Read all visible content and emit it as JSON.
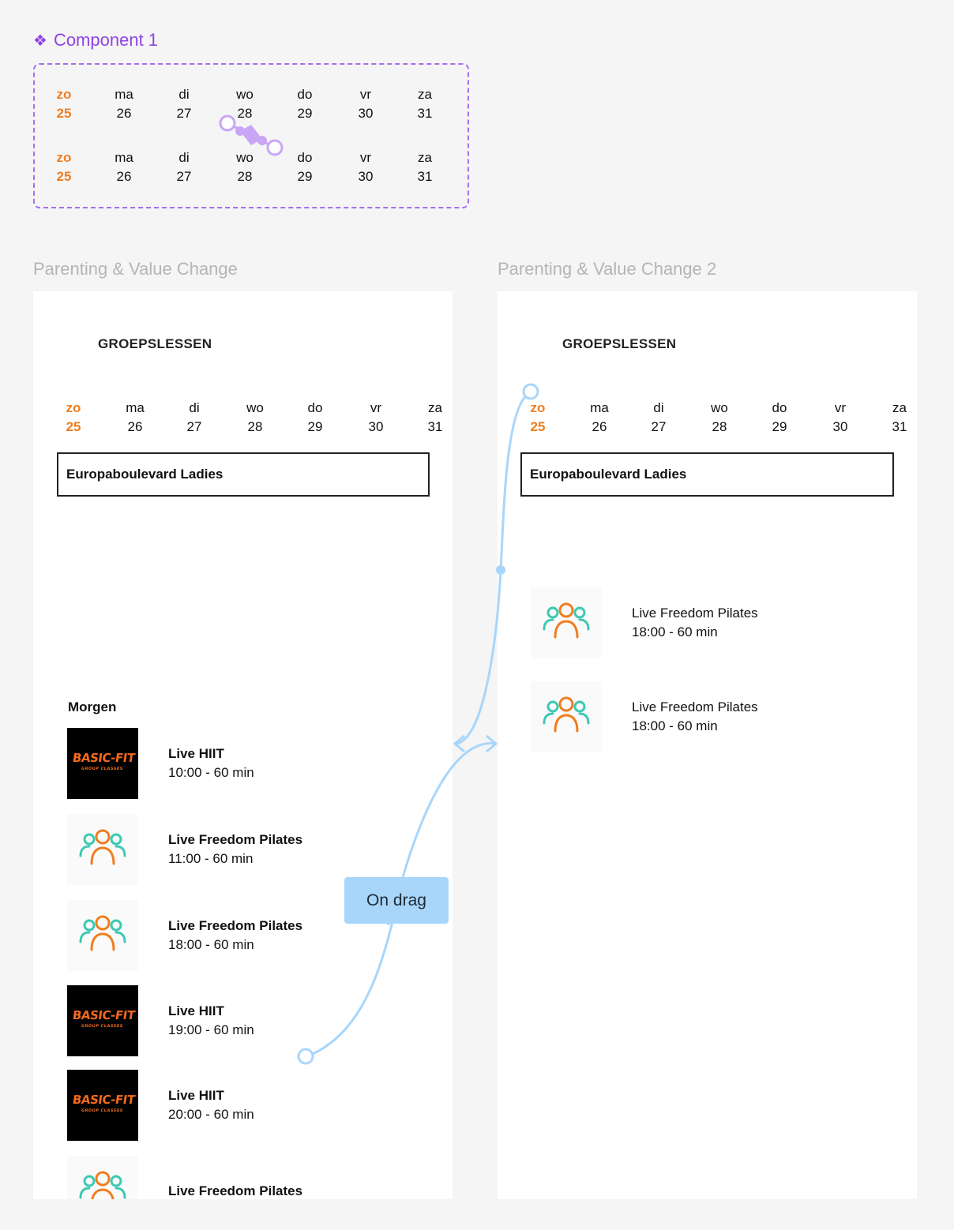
{
  "component": {
    "title": "Component 1",
    "icon": "component-diamond-icon"
  },
  "days": [
    {
      "dow": "zo",
      "num": "25",
      "active": true
    },
    {
      "dow": "ma",
      "num": "26"
    },
    {
      "dow": "di",
      "num": "27"
    },
    {
      "dow": "wo",
      "num": "28"
    },
    {
      "dow": "do",
      "num": "29"
    },
    {
      "dow": "vr",
      "num": "30"
    },
    {
      "dow": "za",
      "num": "31"
    }
  ],
  "frame1": {
    "title": "Parenting & Value Change",
    "heading": "GROEPSLESSEN",
    "location": "Europaboulevard Ladies",
    "section": "Morgen",
    "classes": [
      {
        "name": "Live HIIT",
        "time": "10:00 - 60 min",
        "thumb": "basic-fit-logo"
      },
      {
        "name": "Live Freedom Pilates",
        "time": "11:00 - 60 min",
        "thumb": "group-people-icon"
      },
      {
        "name": "Live Freedom Pilates",
        "time": "18:00 - 60 min",
        "thumb": "group-people-icon"
      },
      {
        "name": "Live HIIT",
        "time": "19:00 - 60 min",
        "thumb": "basic-fit-logo"
      },
      {
        "name": "Live HIIT",
        "time": "20:00 - 60 min",
        "thumb": "basic-fit-logo"
      },
      {
        "name": "Live Freedom Pilates",
        "time": "",
        "thumb": "group-people-icon"
      }
    ]
  },
  "frame2": {
    "title": "Parenting & Value Change 2",
    "heading": "GROEPSLESSEN",
    "location": "Europaboulevard Ladies",
    "classes": [
      {
        "name": "Live Freedom Pilates",
        "time": "18:00 - 60 min",
        "thumb": "group-people-icon"
      },
      {
        "name": "Live Freedom Pilates",
        "time": "18:00 - 60 min",
        "thumb": "group-people-icon"
      }
    ]
  },
  "logo": {
    "brand": "BASIC-FIT",
    "sub": "GROUP CLASSES"
  },
  "interaction": {
    "trigger": "On drag"
  },
  "colors": {
    "accent_orange": "#f07d1f",
    "component_purple": "#8e44e6",
    "prototype_blue": "#a8d6fb",
    "people_teal": "#3cc9b4"
  }
}
